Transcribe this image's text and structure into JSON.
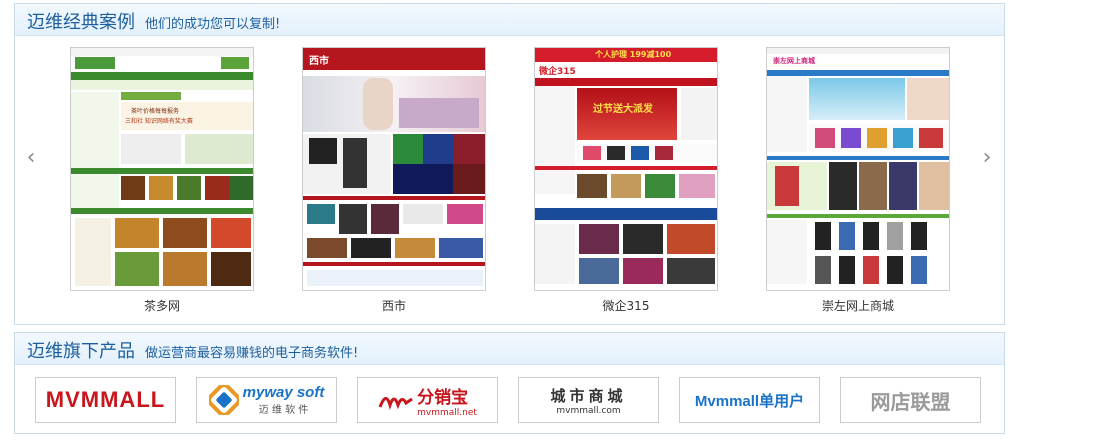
{
  "cases_section": {
    "title": "迈维经典案例",
    "subtitle": "他们的成功您可以复制!",
    "prev_arrow": "‹",
    "next_arrow": "›",
    "items": [
      {
        "label": "茶多网",
        "thumb_caption_1": "茶叶价格每每报务",
        "thumb_caption_2": "三和社 知识网络有奖大赛"
      },
      {
        "label": "西市",
        "thumb_brand": "西市"
      },
      {
        "label": "微企315",
        "thumb_brand": "微企315",
        "thumb_banner": "过节送大派发",
        "thumb_top": "个人护理 199减100"
      },
      {
        "label": "崇左网上商城",
        "thumb_brand": "崇左网上商城"
      }
    ]
  },
  "products_section": {
    "title": "迈维旗下产品",
    "subtitle": "做运营商最容易赚钱的电子商务软件!",
    "logos": [
      {
        "text": "MVMMALL",
        "color": "#c8161d"
      },
      {
        "text": "myway soft",
        "sub": "迈 维 软 件",
        "color": "#1a73c8"
      },
      {
        "text": "分销宝",
        "sub": "mvmmall.net",
        "color": "#c8161d"
      },
      {
        "text": "城市商城",
        "sub": "mvmmall.com",
        "color": "#333333"
      },
      {
        "text": "Mvmmall单用户",
        "color": "#1a73c8"
      },
      {
        "text": "网店联盟",
        "color": "#9a9a9a"
      }
    ]
  }
}
